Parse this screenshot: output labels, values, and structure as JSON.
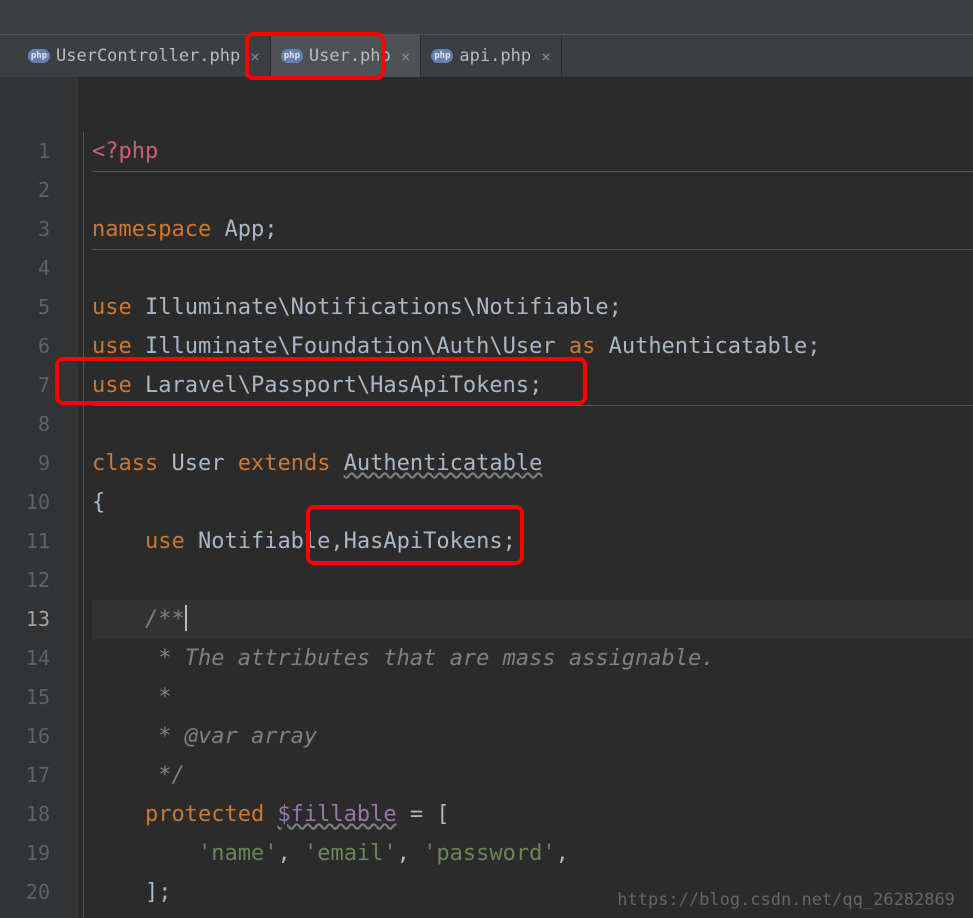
{
  "tabs": [
    {
      "label": "UserController.php",
      "active": false
    },
    {
      "label": "User.php",
      "active": true
    },
    {
      "label": "api.php",
      "active": false
    }
  ],
  "lines": {
    "l1": "1",
    "l2": "2",
    "l3": "3",
    "l4": "4",
    "l5": "5",
    "l6": "6",
    "l7": "7",
    "l8": "8",
    "l9": "9",
    "l10": "10",
    "l11": "11",
    "l12": "12",
    "l13": "13",
    "l14": "14",
    "l15": "15",
    "l16": "16",
    "l17": "17",
    "l18": "18",
    "l19": "19",
    "l20": "20"
  },
  "code": {
    "php_open": "<?php",
    "namespace_kw": "namespace ",
    "namespace_val": "App;",
    "use1_kw": "use ",
    "use1_val": "Illuminate\\Notifications\\Notifiable;",
    "use2_kw": "use ",
    "use2_val1": "Illuminate\\Foundation\\Auth\\User ",
    "use2_as": "as ",
    "use2_val2": "Authenticatable;",
    "use3_kw": "use ",
    "use3_val": "Laravel\\Passport\\HasApiTokens;",
    "class_kw": "class ",
    "class_name": "User ",
    "extends_kw": "extends ",
    "extends_val": "Authenticatable",
    "brace_open": "{",
    "use_traits_kw": "use ",
    "use_traits_val": "Notifiable,HasApiTokens;",
    "comment_open": "/**",
    "comment_desc": " * The attributes that are mass assignable.",
    "comment_star": " *",
    "comment_var": " * @var array",
    "comment_close": " */",
    "prot_kw": "protected ",
    "fillable_var": "$fillable",
    "fillable_eq": " = [",
    "fill_name": "'name'",
    "fill_comma1": ", ",
    "fill_email": "'email'",
    "fill_comma2": ", ",
    "fill_pass": "'password'",
    "fill_comma3": ",",
    "array_close": "];"
  },
  "watermark": "https://blog.csdn.net/qq_26282869",
  "php_badge": "php"
}
